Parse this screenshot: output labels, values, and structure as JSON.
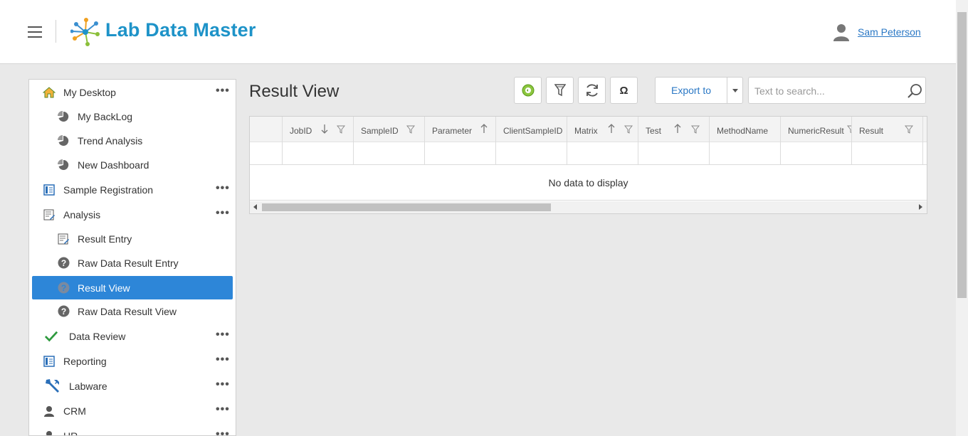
{
  "header": {
    "app_title": "Lab Data Master",
    "user_name": "Sam Peterson",
    "brand_color": "#1e93c8"
  },
  "sidebar": {
    "items": [
      {
        "label": "My Desktop",
        "icon": "home-icon",
        "more": "•••"
      },
      {
        "label": "My BackLog",
        "icon": "pie-chart-icon"
      },
      {
        "label": "Trend Analysis",
        "icon": "pie-chart-icon"
      },
      {
        "label": "New Dashboard",
        "icon": "pie-chart-icon"
      },
      {
        "label": "Sample Registration",
        "icon": "form-icon",
        "more": "•••"
      },
      {
        "label": "Analysis",
        "icon": "edit-form-icon",
        "more": "•••"
      },
      {
        "label": "Result Entry",
        "icon": "edit-form-icon"
      },
      {
        "label": "Raw Data Result Entry",
        "icon": "question-icon"
      },
      {
        "label": "Result View",
        "icon": "question-icon",
        "active": true
      },
      {
        "label": "Raw Data Result View",
        "icon": "question-icon"
      },
      {
        "label": "Data Review",
        "icon": "checkmark-icon",
        "more": "•••"
      },
      {
        "label": "Reporting",
        "icon": "form-icon",
        "more": "•••"
      },
      {
        "label": "Labware",
        "icon": "wrench-icon",
        "more": "•••"
      },
      {
        "label": "CRM",
        "icon": "person-icon",
        "more": "•••"
      },
      {
        "label": "HR",
        "icon": "person-icon",
        "more": "•••"
      }
    ],
    "active_color": "#2d86d8"
  },
  "main": {
    "title": "Result View",
    "toolbar": {
      "add_icon": "add-circle-icon",
      "filter_icon": "filter-icon",
      "refresh_icon": "refresh-icon",
      "omega_label": "Ω",
      "export_label": "Export to"
    },
    "search": {
      "placeholder": "Text to search..."
    },
    "grid": {
      "columns": [
        {
          "label": "JobID",
          "sort": "desc",
          "filter": true
        },
        {
          "label": "SampleID",
          "sort": "",
          "filter": true
        },
        {
          "label": "Parameter",
          "sort": "asc",
          "filter": false
        },
        {
          "label": "ClientSampleID",
          "sort": "",
          "filter": false
        },
        {
          "label": "Matrix",
          "sort": "asc",
          "filter": true
        },
        {
          "label": "Test",
          "sort": "asc",
          "filter": true
        },
        {
          "label": "MethodName",
          "sort": "",
          "filter": false
        },
        {
          "label": "NumericResult",
          "sort": "",
          "filter": true
        },
        {
          "label": "Result",
          "sort": "",
          "filter": true
        }
      ],
      "empty_text": "No data to display"
    }
  }
}
